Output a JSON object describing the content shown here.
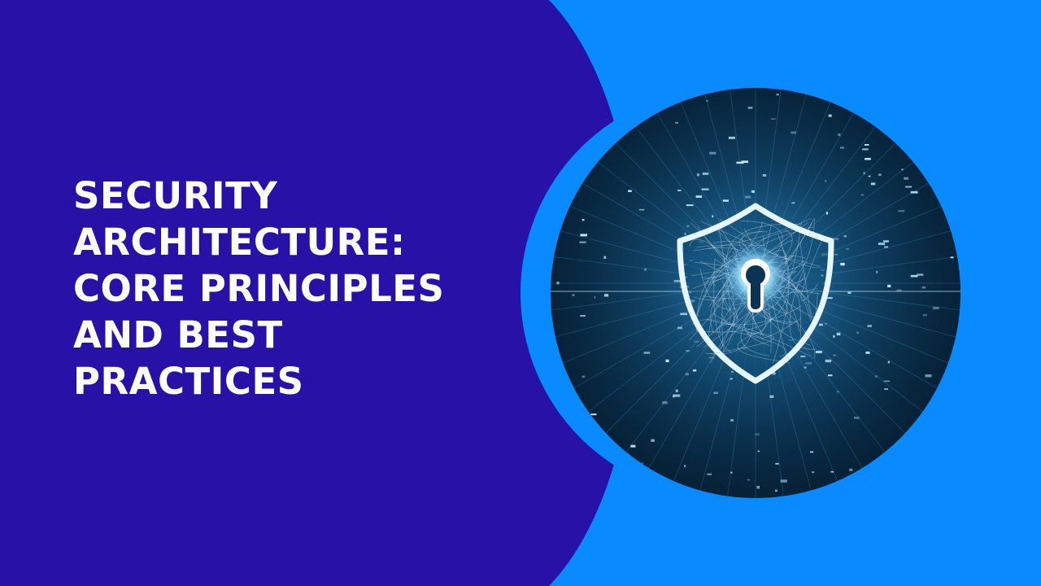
{
  "slide": {
    "title_lines": [
      "SECURITY",
      "ARCHITECTURE:",
      "CORE PRINCIPLES",
      "AND BEST",
      "PRACTICES"
    ],
    "colors": {
      "panel_dark": "#2811a6",
      "panel_light": "#0a8aff",
      "title_text": "#ffffff",
      "glow": "#bfe8ff"
    },
    "image": {
      "subject": "shield-with-keyhole-icon",
      "background": "data-grid-icon"
    }
  }
}
